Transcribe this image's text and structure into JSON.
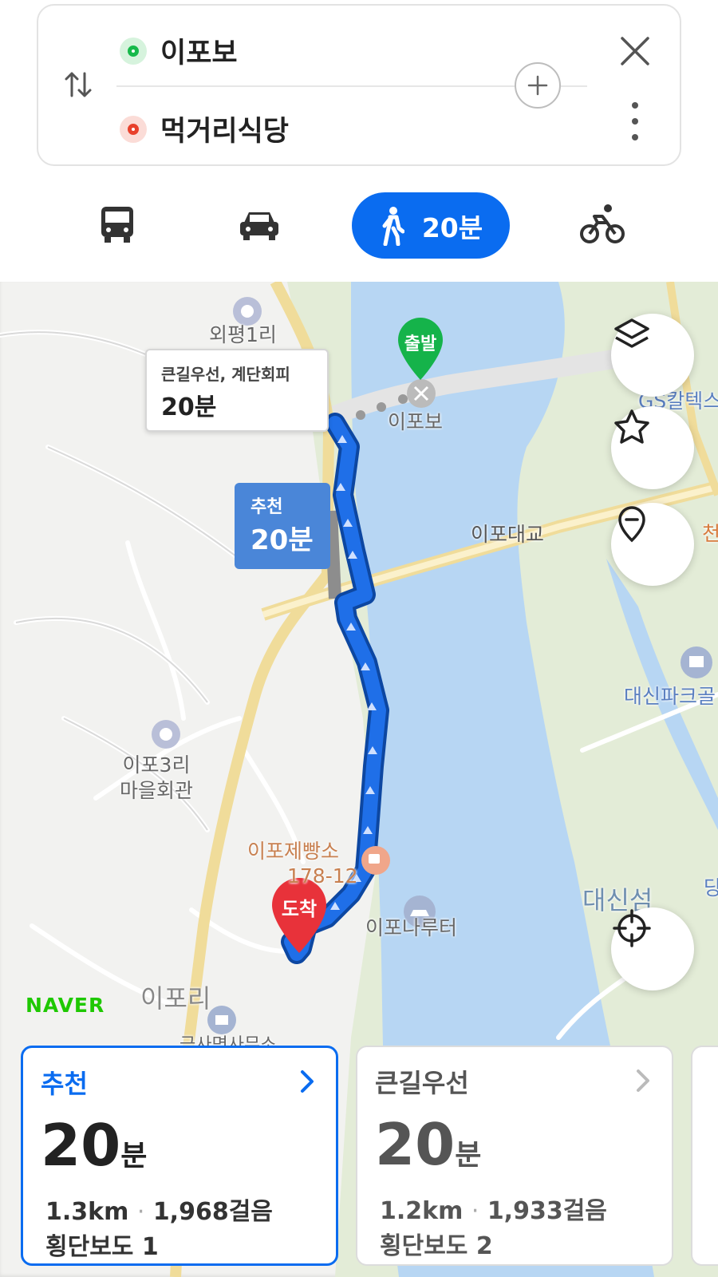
{
  "route": {
    "origin": "이포보",
    "destination": "먹거리식당"
  },
  "modes": {
    "active": "walk",
    "walk_time": "20분"
  },
  "map": {
    "labels": {
      "oepyeong": "외평1리",
      "ipobo": "이포보",
      "ipo_bridge": "이포대교",
      "gs_caltex": "GS칼텍스",
      "cheon": "천",
      "daesin_park": "대신파크골",
      "ipo3": "이포3리\n마을회관",
      "bakery": "이포제빵소",
      "bakery_addr": "178-12",
      "ferry": "이포나루터",
      "daesin_island": "대신섬",
      "ipori": "이포리",
      "office": "금사면사무소",
      "dang": "당"
    },
    "bubble_sub": "큰길우선, 계단회피",
    "bubble_time": "20분",
    "rec_label": "추천",
    "rec_time": "20분",
    "start_pin": "출발",
    "end_pin": "도착",
    "brand": "NAVER",
    "accent": "#0a6cf0",
    "route_color": "#1565e0",
    "water_color": "#b6d6f2",
    "park_color": "#e2ecd6"
  },
  "cards": [
    {
      "name": "추천",
      "time_num": "20",
      "time_unit": "분",
      "distance": "1.3km",
      "steps": "1,968걸음",
      "crosswalks": "횡단보도 1",
      "selected": true
    },
    {
      "name": "큰길우선",
      "time_num": "20",
      "time_unit": "분",
      "distance": "1.2km",
      "steps": "1,933걸음",
      "crosswalks": "횡단보도 2",
      "selected": false
    }
  ]
}
